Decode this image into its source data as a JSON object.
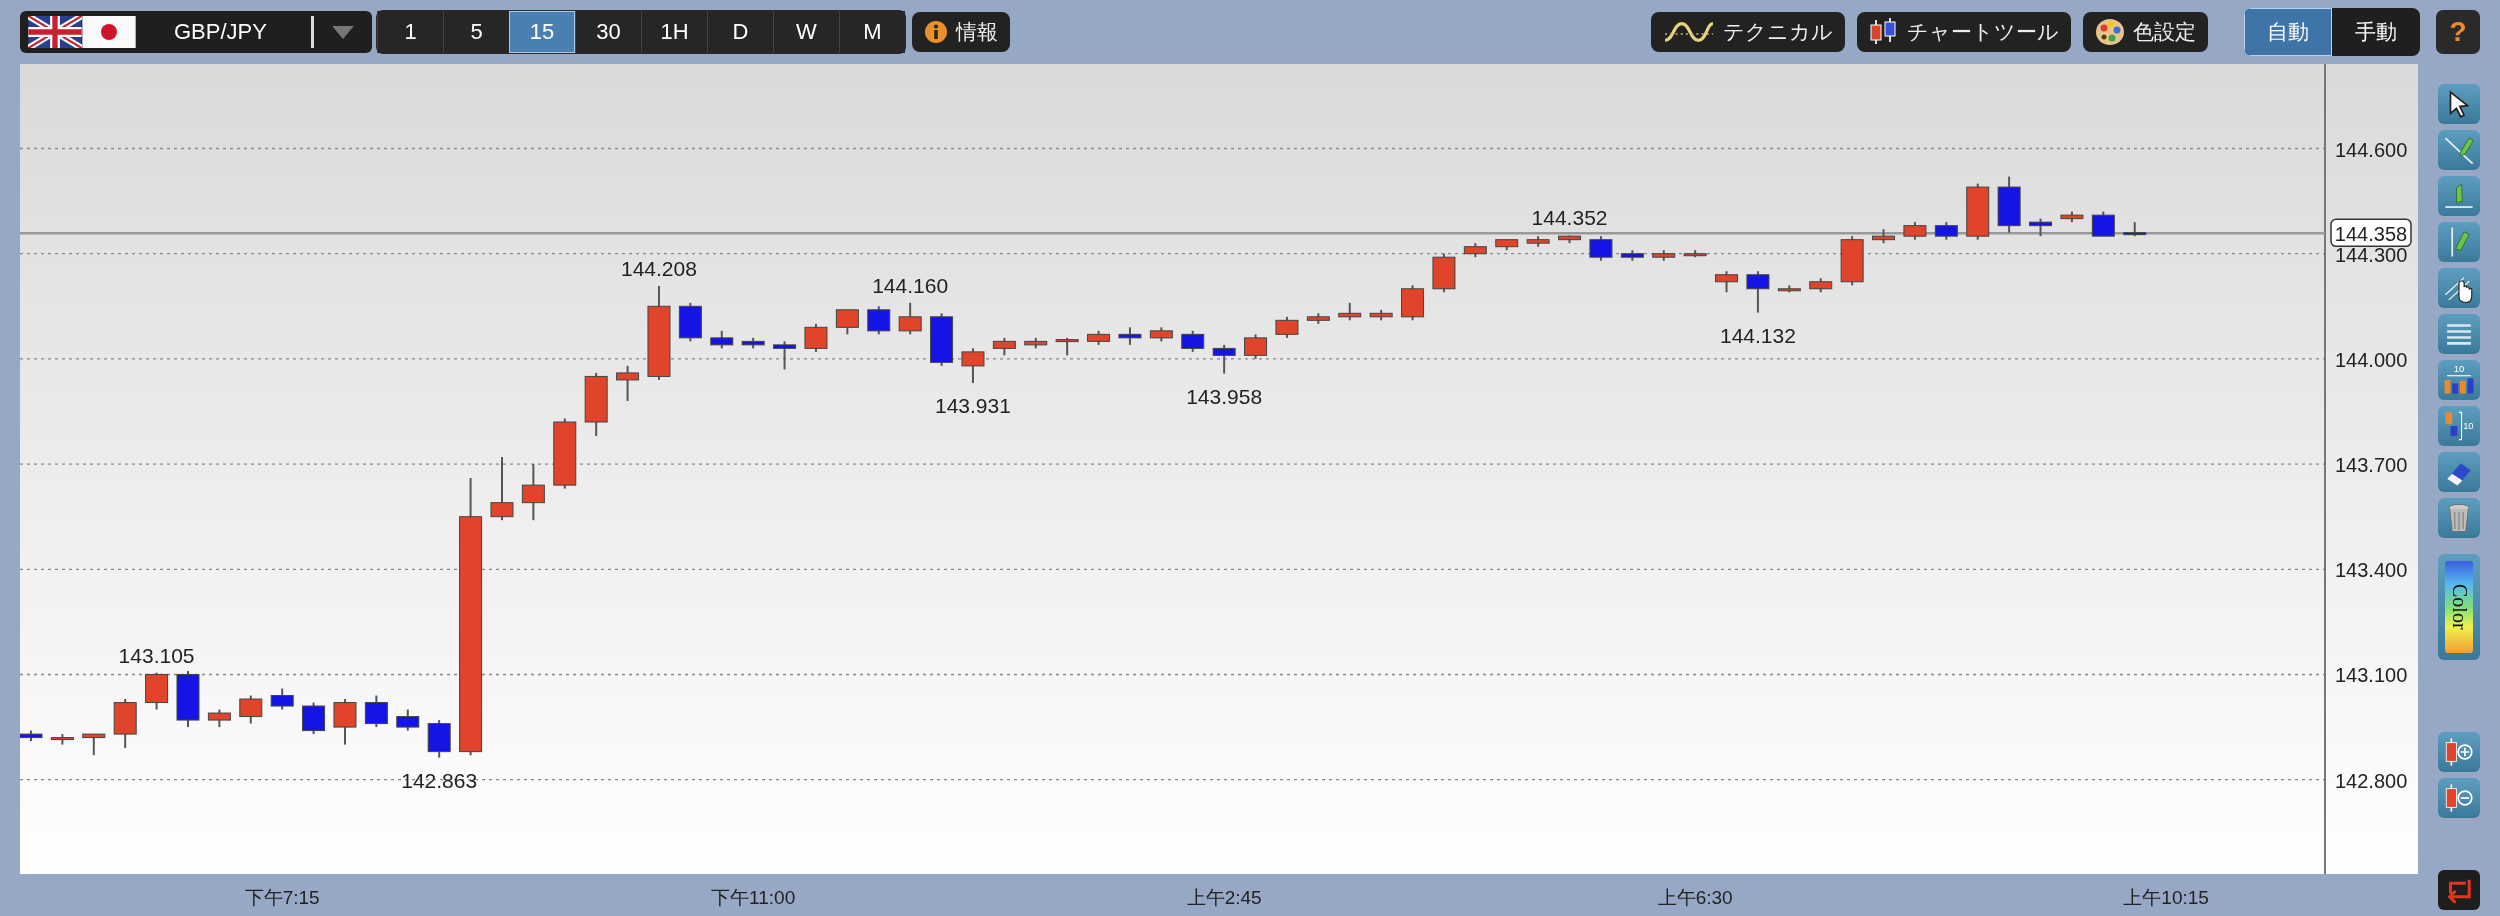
{
  "symbol": "GBP/JPY",
  "timeframes": [
    {
      "label": "1",
      "selected": false
    },
    {
      "label": "5",
      "selected": false
    },
    {
      "label": "15",
      "selected": true
    },
    {
      "label": "30",
      "selected": false
    },
    {
      "label": "1H",
      "selected": false
    },
    {
      "label": "D",
      "selected": false
    },
    {
      "label": "W",
      "selected": false
    },
    {
      "label": "M",
      "selected": false
    }
  ],
  "info_button": "情報",
  "tool_buttons": [
    {
      "kind": "technical",
      "label": "テクニカル"
    },
    {
      "kind": "chart_tools",
      "label": "チャートツール"
    },
    {
      "kind": "colors",
      "label": "色設定"
    }
  ],
  "mode_toggle": [
    {
      "label": "自動",
      "selected": true
    },
    {
      "label": "手動",
      "selected": false
    }
  ],
  "help_button": "?",
  "chart": {
    "price_axis": [
      "144.600",
      "144.300",
      "144.000",
      "143.700",
      "143.400",
      "143.100",
      "142.800"
    ],
    "time_axis": [
      "下午7:15",
      "下午11:00",
      "上午2:45",
      "上午6:30",
      "上午10:15"
    ],
    "price_labels": [
      "143.105",
      "142.863",
      "144.208",
      "144.160",
      "143.931",
      "143.958",
      "144.352",
      "144.132"
    ],
    "current_price": "144.358"
  },
  "side_toolbar": [
    {
      "kind": "pointer"
    },
    {
      "kind": "trend_line"
    },
    {
      "kind": "horizontal_line"
    },
    {
      "kind": "vertical_line"
    },
    {
      "kind": "hand"
    },
    {
      "kind": "lines"
    },
    {
      "kind": "range_count",
      "label": "10"
    },
    {
      "kind": "bar_count",
      "label": "10"
    },
    {
      "kind": "eraser"
    },
    {
      "kind": "trash"
    },
    {
      "kind": "color",
      "label": "Color"
    },
    {
      "kind": "zoom_in"
    },
    {
      "kind": "zoom_out"
    },
    {
      "kind": "exit"
    }
  ]
}
